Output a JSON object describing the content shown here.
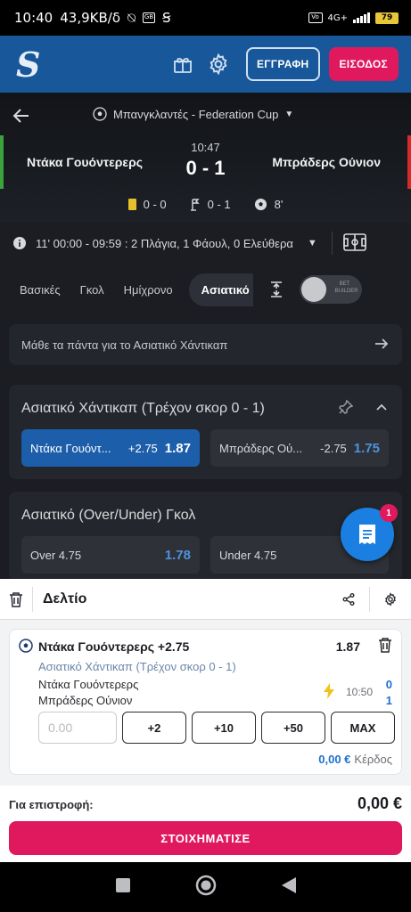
{
  "status_bar": {
    "time": "10:40",
    "speed": "43,9KB/δ",
    "network": "4G+",
    "battery": "79"
  },
  "header": {
    "register_label": "ΕΓΓΡΑΦΗ",
    "login_label": "ΕΙΣΟΔΟΣ",
    "colors": {
      "header_bg": "#17579a",
      "login_bg": "#e0195f"
    }
  },
  "match": {
    "league": "Μπανγκλαντές - Federation Cup",
    "home_team": "Ντάκα Γουόντερερς",
    "away_team": "Μπράδερς Ούνιον",
    "time": "10:47",
    "score": "0 - 1",
    "stats": {
      "cards": "0 - 0",
      "corners": "0 - 1",
      "minute": "8'"
    }
  },
  "info_row": {
    "text": "11'  00:00 - 09:59 : 2 Πλάγια, 1 Φάουλ, 0 Ελεύθερα"
  },
  "tabs": {
    "items": [
      "Βασικές",
      "Γκολ",
      "Ημίχρονο",
      "Ασιατικό"
    ],
    "active": "Ασιατικό",
    "toggle_label": "BET BUILDER"
  },
  "learn_banner": {
    "text": "Μάθε τα πάντα για το Ασιατικό Χάντικαπ"
  },
  "markets": [
    {
      "title": "Ασιατικό Χάντικαπ (Τρέχον σκορ 0 - 1)",
      "outcomes": [
        {
          "name": "Ντάκα Γουόντ...",
          "line": "+2.75",
          "price": "1.87",
          "selected": true
        },
        {
          "name": "Μπράδερς Ού...",
          "line": "-2.75",
          "price": "1.75",
          "selected": false
        }
      ]
    },
    {
      "title": "Ασιατικό (Over/Under) Γκολ",
      "outcomes": [
        {
          "name": "Over 4.75",
          "line": "",
          "price": "1.78",
          "selected": false
        },
        {
          "name": "Under 4.75",
          "line": "",
          "price": "",
          "selected": false
        }
      ]
    }
  ],
  "fab": {
    "badge": "1"
  },
  "betslip": {
    "title": "Δελτίο",
    "selection": {
      "name": "Ντάκα Γουόντερερς +2.75",
      "price": "1.87",
      "market": "Ασιατικό Χάντικαπ (Τρέχον σκορ 0 - 1)",
      "team1": "Ντάκα Γουόντερερς",
      "team2": "Μπράδερς Ούνιον",
      "time": "10:50",
      "score1": "0",
      "score2": "1"
    },
    "stake_placeholder": "0.00",
    "quick_stakes": [
      "+2",
      "+10",
      "+50",
      "MAX"
    ],
    "potential_win": "0,00 €",
    "potential_win_label": "Κέρδος",
    "return_label": "Για επιστροφή:",
    "return_amount": "0,00 €",
    "place_bet_label": "ΣΤΟΙΧΗΜΑΤΙΣΕ"
  }
}
